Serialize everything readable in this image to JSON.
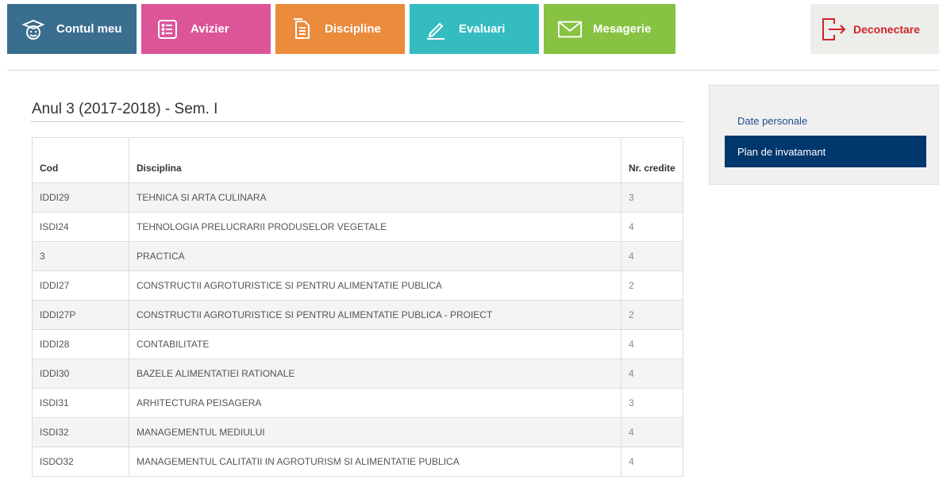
{
  "nav": {
    "items": [
      {
        "label": "Contul meu",
        "icon": "graduate-icon",
        "color": "#3a6e8f"
      },
      {
        "label": "Avizier",
        "icon": "list-icon",
        "color": "#dc5598"
      },
      {
        "label": "Discipline",
        "icon": "document-icon",
        "color": "#eb8b3c"
      },
      {
        "label": "Evaluari",
        "icon": "pen-icon",
        "color": "#35bcc0"
      },
      {
        "label": "Mesagerie",
        "icon": "envelope-icon",
        "color": "#87c242"
      }
    ],
    "logout_label": "Deconectare",
    "logout_color": "#d0242b"
  },
  "main": {
    "semester_title": "Anul 3 (2017-2018) - Sem. I",
    "table": {
      "headers": [
        "Cod",
        "Disciplina",
        "Nr. credite"
      ],
      "rows": [
        [
          "IDDI29",
          "TEHNICA SI ARTA CULINARA",
          "3"
        ],
        [
          "ISDI24",
          "TEHNOLOGIA PRELUCRARII PRODUSELOR VEGETALE",
          "4"
        ],
        [
          "3",
          "PRACTICA",
          "4"
        ],
        [
          "IDDI27",
          "CONSTRUCTII AGROTURISTICE SI PENTRU ALIMENTATIE PUBLICA",
          "2"
        ],
        [
          "IDDI27P",
          "CONSTRUCTII AGROTURISTICE SI PENTRU ALIMENTATIE PUBLICA - PROIECT",
          "2"
        ],
        [
          "IDDI28",
          "CONTABILITATE",
          "4"
        ],
        [
          "IDDI30",
          "BAZELE ALIMENTATIEI RATIONALE",
          "4"
        ],
        [
          "ISDI31",
          "ARHITECTURA PEISAGERA",
          "3"
        ],
        [
          "ISDI32",
          "MANAGEMENTUL MEDIULUI",
          "4"
        ],
        [
          "ISDO32",
          "MANAGEMENTUL CALITATII IN AGROTURISM SI ALIMENTATIE PUBLICA",
          "4"
        ]
      ]
    }
  },
  "sidebar": {
    "items": [
      {
        "label": "Date personale",
        "active": false
      },
      {
        "label": "Plan de invatamant",
        "active": true
      }
    ],
    "active_color": "#00376d"
  }
}
